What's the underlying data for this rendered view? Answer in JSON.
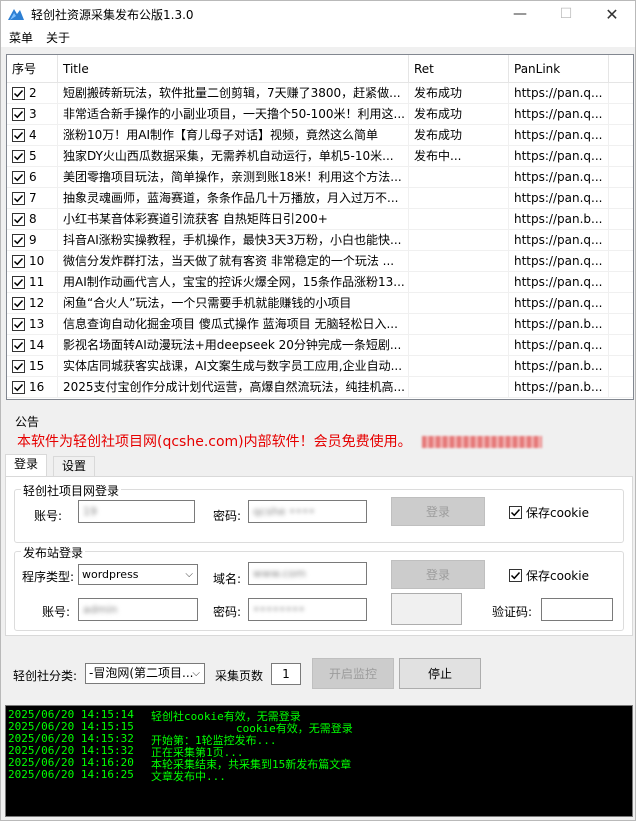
{
  "window": {
    "title": "轻创社资源采集发布公版1.3.0",
    "min_glyph": "—",
    "max_glyph": "☐",
    "close_glyph": "✕"
  },
  "menu": {
    "items": [
      "菜单",
      "关于"
    ]
  },
  "table": {
    "columns": [
      "序号",
      "Title",
      "Ret",
      "PanLink"
    ],
    "rows": [
      {
        "no": "2",
        "title": "短剧搬砖新玩法，软件批量二创剪辑，7天赚了3800，赶紧做...",
        "ret": "发布成功",
        "link": "https://pan.q..."
      },
      {
        "no": "3",
        "title": "非常适合新手操作的小副业项目，一天撸个50-100米！利用这...",
        "ret": "发布成功",
        "link": "https://pan.q..."
      },
      {
        "no": "4",
        "title": "涨粉10万！用AI制作【育儿母子对话】视频，竟然这么简单",
        "ret": "发布成功",
        "link": "https://pan.q..."
      },
      {
        "no": "5",
        "title": "独家DY火山西瓜数据采集，无需养机自动运行，单机5-10米...",
        "ret": "发布中...",
        "link": "https://pan.q..."
      },
      {
        "no": "6",
        "title": "美团零撸项目玩法，简单操作，亲测到账18米！利用这个方法...",
        "ret": "",
        "link": "https://pan.q..."
      },
      {
        "no": "7",
        "title": "抽象灵魂画师，蓝海赛道，条条作品几十万播放，月入过万不...",
        "ret": "",
        "link": "https://pan.q..."
      },
      {
        "no": "8",
        "title": "小红书某音体彩赛道引流获客 自热矩阵日引200+",
        "ret": "",
        "link": "https://pan.b..."
      },
      {
        "no": "9",
        "title": "抖音AI涨粉实操教程，手机操作，最快3天3万粉，小白也能快...",
        "ret": "",
        "link": "https://pan.q..."
      },
      {
        "no": "10",
        "title": "微信分发炸群打法，当天做了就有客资 非常稳定的一个玩法 ...",
        "ret": "",
        "link": "https://pan.q..."
      },
      {
        "no": "11",
        "title": "用AI制作动画代言人，宝宝的控诉火爆全网，15条作品涨粉13...",
        "ret": "",
        "link": "https://pan.q..."
      },
      {
        "no": "12",
        "title": "闲鱼“合火人”玩法，一个只需要手机就能赚钱的小项目",
        "ret": "",
        "link": "https://pan.q..."
      },
      {
        "no": "13",
        "title": "信息查询自动化掘金项目 傻瓜式操作  蓝海项目 无脑轻松日入...",
        "ret": "",
        "link": "https://pan.b..."
      },
      {
        "no": "14",
        "title": "影视名场面转AI动漫玩法+用deepseek 20分钟完成一条短剧...",
        "ret": "",
        "link": "https://pan.q..."
      },
      {
        "no": "15",
        "title": "实体店同城获客实战课，AI文案生成与数字员工应用,企业自动...",
        "ret": "",
        "link": "https://pan.b..."
      },
      {
        "no": "16",
        "title": "2025支付宝创作分成计划代运营，高爆自然流玩法，纯挂机高...",
        "ret": "",
        "link": "https://pan.b..."
      }
    ]
  },
  "notice": {
    "label": "公告",
    "text": "本软件为轻创社项目网(qcshe.com)内部软件！会员免费使用。"
  },
  "tabs": [
    "登录",
    "设置"
  ],
  "login_group": {
    "title": "轻创社项目网登录",
    "account_label": "账号:",
    "account_value": "19",
    "password_label": "密码:",
    "password_value": "qcshe ••••",
    "login_button": "登录",
    "save_cookie": "保存cookie"
  },
  "publish_group": {
    "title": "发布站登录",
    "type_label": "程序类型:",
    "type_value": "wordpress",
    "domain_label": "域名:",
    "domain_value": "www.com",
    "login_button": "登录",
    "save_cookie": "保存cookie",
    "account_label": "账号:",
    "account_value": "admin",
    "password_label": "密码:",
    "password_value": "••••••••",
    "captcha_label": "验证码:"
  },
  "controls": {
    "category_label": "轻创社分类:",
    "category_value": "-冒泡网(第二项目...",
    "pages_label": "采集页数",
    "pages_value": "1",
    "start_button": "开启监控",
    "stop_button": "停止"
  },
  "log": [
    {
      "time": "2025/06/20 14:15:14",
      "msg": "轻创社cookie有效，无需登录"
    },
    {
      "time": "2025/06/20 14:15:15",
      "msg": "cookie有效，无需登录"
    },
    {
      "time": "2025/06/20 14:15:32",
      "msg": "开始第：1轮监控发布..."
    },
    {
      "time": "2025/06/20 14:15:32",
      "msg": "正在采集第1页..."
    },
    {
      "time": "2025/06/20 14:16:20",
      "msg": "本轮采集结束，共采集到15新发布篇文章"
    },
    {
      "time": "2025/06/20 14:16:25",
      "msg": "文章发布中..."
    }
  ],
  "colors": {
    "notice_red": "#e60000",
    "log_green": "#00ff00",
    "log_bg": "#000000"
  }
}
